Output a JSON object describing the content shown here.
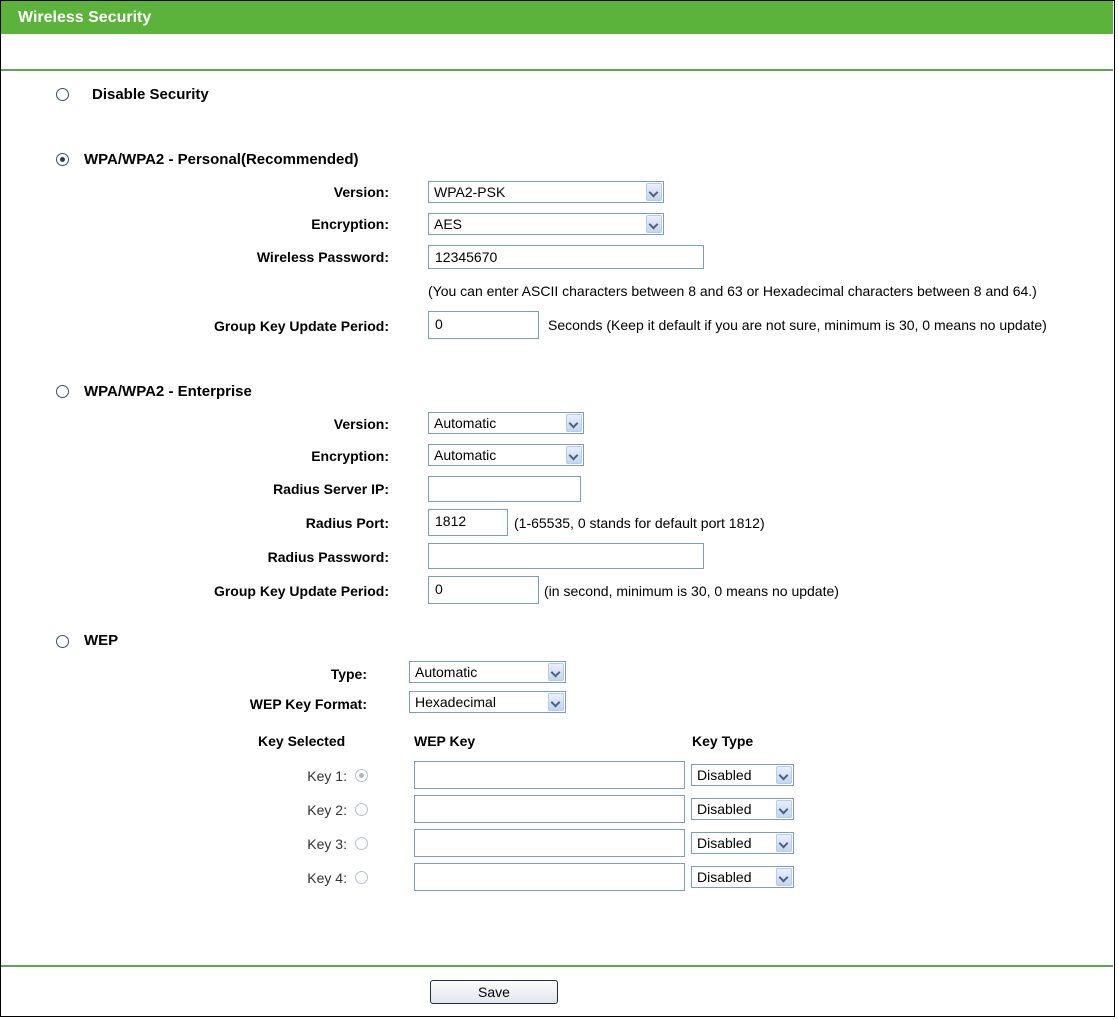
{
  "header": {
    "title": "Wireless Security"
  },
  "disable": {
    "label": "Disable Security",
    "selected": false
  },
  "personal": {
    "label": "WPA/WPA2 - Personal(Recommended)",
    "selected": true,
    "version_label": "Version:",
    "version_value": "WPA2-PSK",
    "encryption_label": "Encryption:",
    "encryption_value": "AES",
    "password_label": "Wireless Password:",
    "password_value": "12345670",
    "password_hint": "(You can enter ASCII characters between 8 and 63 or Hexadecimal characters between 8 and 64.)",
    "gkup_label": "Group Key Update Period:",
    "gkup_value": "0",
    "gkup_hint": "Seconds (Keep it default if you are not sure, minimum is 30, 0 means no update)"
  },
  "enterprise": {
    "label": "WPA/WPA2 - Enterprise",
    "selected": false,
    "version_label": "Version:",
    "version_value": "Automatic",
    "encryption_label": "Encryption:",
    "encryption_value": "Automatic",
    "radius_ip_label": "Radius Server IP:",
    "radius_ip_value": "",
    "radius_port_label": "Radius Port:",
    "radius_port_value": "1812",
    "radius_port_hint": "(1-65535, 0 stands for default port 1812)",
    "radius_pw_label": "Radius Password:",
    "radius_pw_value": "",
    "gkup_label": "Group Key Update Period:",
    "gkup_value": "0",
    "gkup_hint": "(in second, minimum is 30, 0 means no update)"
  },
  "wep": {
    "label": "WEP",
    "selected": false,
    "type_label": "Type:",
    "type_value": "Automatic",
    "format_label": "WEP Key Format:",
    "format_value": "Hexadecimal",
    "col_selected": "Key Selected",
    "col_key": "WEP Key",
    "col_type": "Key Type",
    "keys": [
      {
        "label": "Key 1:",
        "selected": true,
        "value": "",
        "type": "Disabled"
      },
      {
        "label": "Key 2:",
        "selected": false,
        "value": "",
        "type": "Disabled"
      },
      {
        "label": "Key 3:",
        "selected": false,
        "value": "",
        "type": "Disabled"
      },
      {
        "label": "Key 4:",
        "selected": false,
        "value": "",
        "type": "Disabled"
      }
    ]
  },
  "footer": {
    "save_label": "Save"
  },
  "colors": {
    "header_bg": "#5cb33c",
    "divider": "#5fa35c"
  }
}
